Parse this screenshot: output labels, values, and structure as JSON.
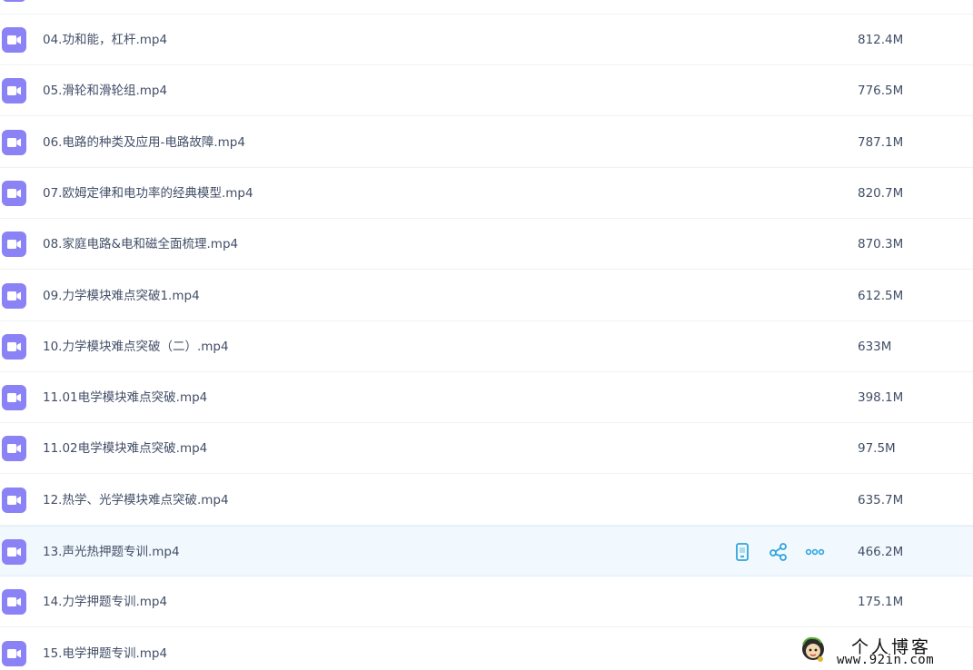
{
  "colors": {
    "video_icon": "#8a82f5",
    "action_icon": "#2fa3de",
    "text": "#424e67",
    "hover_row": "#f2f9fe"
  },
  "row_icon": "video-file-icon",
  "row_actions": [
    {
      "name": "phone-icon",
      "label": "send-to-phone"
    },
    {
      "name": "share-icon",
      "label": "share"
    },
    {
      "name": "more-icon",
      "label": "more"
    }
  ],
  "files": [
    {
      "name": "04.功和能，杠杆.mp4",
      "size": "812.4M"
    },
    {
      "name": "05.滑轮和滑轮组.mp4",
      "size": "776.5M"
    },
    {
      "name": "06.电路的种类及应用-电路故障.mp4",
      "size": "787.1M"
    },
    {
      "name": "07.欧姆定律和电功率的经典模型.mp4",
      "size": "820.7M"
    },
    {
      "name": "08.家庭电路&电和磁全面梳理.mp4",
      "size": "870.3M"
    },
    {
      "name": "09.力学模块难点突破1.mp4",
      "size": "612.5M"
    },
    {
      "name": "10.力学模块难点突破（二）.mp4",
      "size": "633M"
    },
    {
      "name": "11.01电学模块难点突破.mp4",
      "size": "398.1M"
    },
    {
      "name": "11.02电学模块难点突破.mp4",
      "size": "97.5M"
    },
    {
      "name": "12.热学、光学模块难点突破.mp4",
      "size": "635.7M"
    },
    {
      "name": "13.声光热押题专训.mp4",
      "size": "466.2M",
      "hovered": true
    },
    {
      "name": "14.力学押题专训.mp4",
      "size": "175.1M"
    },
    {
      "name": "15.电学押题专训.mp4",
      "size": ""
    }
  ],
  "watermark": {
    "title": "个人博客",
    "url": "www.92in.com"
  }
}
